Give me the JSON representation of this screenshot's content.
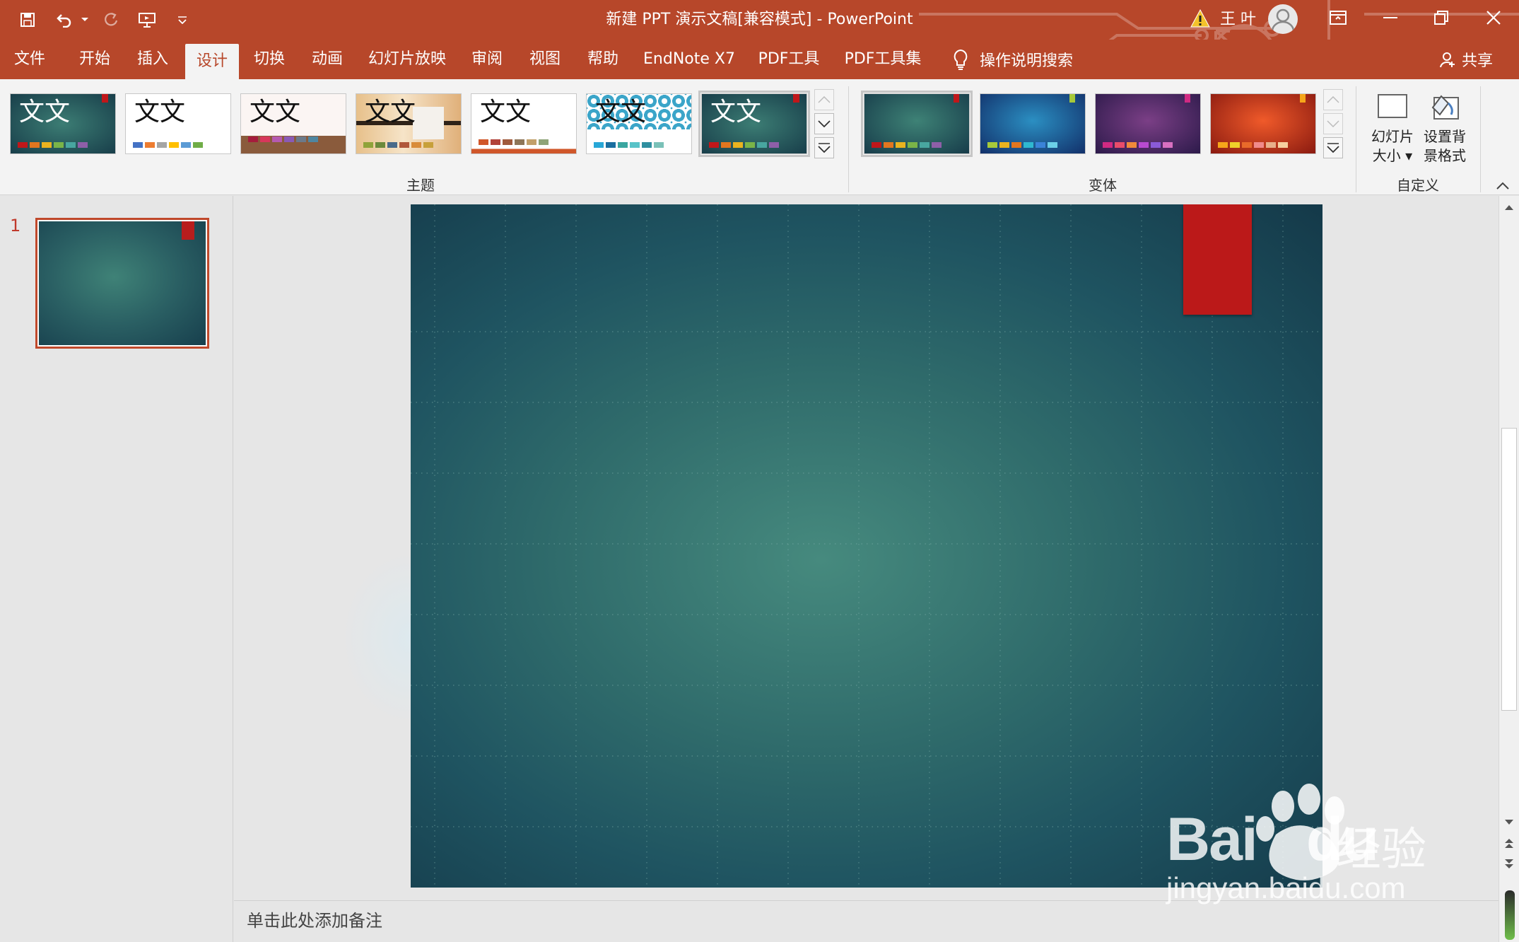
{
  "window": {
    "title": "新建 PPT 演示文稿[兼容模式]  -  PowerPoint",
    "user_name": "王 叶"
  },
  "tabs": [
    {
      "label": "文件"
    },
    {
      "label": "开始"
    },
    {
      "label": "插入"
    },
    {
      "label": "设计"
    },
    {
      "label": "切换"
    },
    {
      "label": "动画"
    },
    {
      "label": "幻灯片放映"
    },
    {
      "label": "审阅"
    },
    {
      "label": "视图"
    },
    {
      "label": "帮助"
    },
    {
      "label": "EndNote X7"
    },
    {
      "label": "PDF工具"
    },
    {
      "label": "PDF工具集"
    }
  ],
  "active_tab": "设计",
  "tell_me": "操作说明搜索",
  "share": "共享",
  "ribbon": {
    "themes_label": "主题",
    "variants_label": "变体",
    "customize_label": "自定义",
    "theme_sample_text": "文文",
    "slide_size": {
      "line1": "幻灯片",
      "line2": "大小"
    },
    "format_bg": {
      "line1": "设置背",
      "line2": "景格式"
    }
  },
  "slides": [
    {
      "number": "1"
    }
  ],
  "notes_placeholder": "单击此处添加备注",
  "watermark": {
    "brand": "Bai",
    "brand2": "du",
    "cn": "经验",
    "url": "jingyan.baidu.com"
  },
  "colors": {
    "accent": "#b7472a",
    "slide_flag": "#bb1919",
    "slide_center": "#468a7e",
    "slide_edge": "#143949"
  }
}
